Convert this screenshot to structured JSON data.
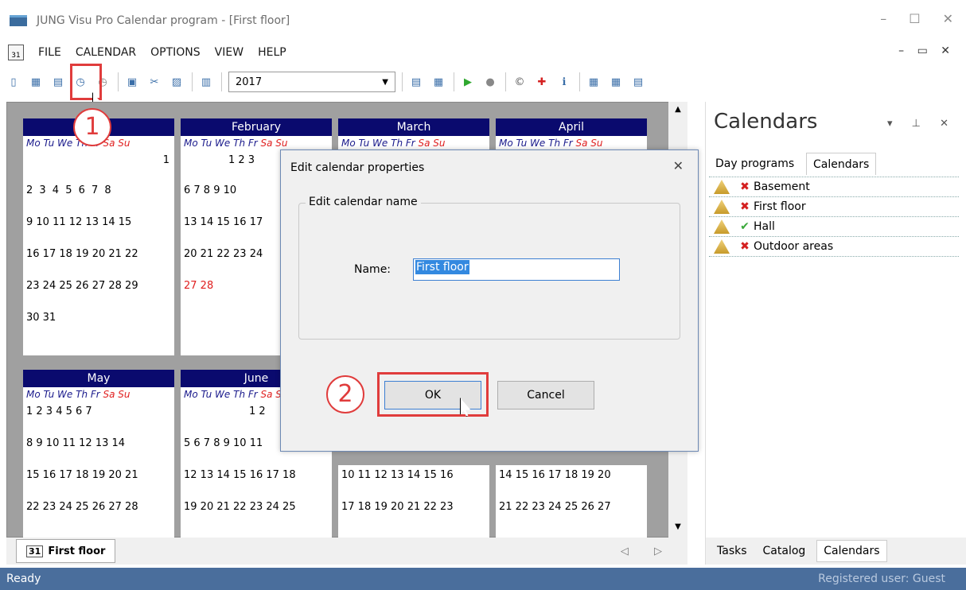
{
  "window": {
    "title": "JUNG Visu Pro Calendar program - [First floor]"
  },
  "menu": [
    "FILE",
    "CALENDAR",
    "OPTIONS",
    "VIEW",
    "HELP"
  ],
  "toolbar": {
    "year": "2017"
  },
  "months": [
    {
      "name": "January",
      "label_visible": "ary"
    },
    {
      "name": "February",
      "label_visible": "February"
    },
    {
      "name": "March",
      "label_visible": "March"
    },
    {
      "name": "April",
      "label_visible": "April"
    },
    {
      "name": "May",
      "label_visible": "May"
    },
    {
      "name": "June",
      "label_visible": "June"
    }
  ],
  "dow_labels": [
    "Mo",
    "Tu",
    "We",
    "Th",
    "Fr",
    "Sa",
    "Su"
  ],
  "calendar_rows": {
    "jan": [
      "1",
      "2 3 4 5 6 7 8",
      "9 10 11 12 13 14 15",
      "16 17 18 19 20 21 22",
      "23 24 25 26 27 28 29",
      "30 31"
    ],
    "feb": [
      "1 2 3",
      "6 7 8 9 10",
      "13 14 15 16 17",
      "20 21 22 23 24",
      "27 28"
    ],
    "may": [
      "1 2 3 4 5 6 7",
      "8 9 10 11 12 13 14",
      "15 16 17 18 19 20 21",
      "22 23 24 25 26 27 28"
    ],
    "jun": [
      "1 2",
      "5 6 7 8 9 10 11",
      "12 13 14 15 16 17 18",
      "19 20 21 22 23 24 25"
    ],
    "jul": [
      "10 11 12 13 14 15 16",
      "17 18 19 20 21 22 23"
    ],
    "aug": [
      "14 15 16 17 18 19 20",
      "21 22 23 24 25 26 27"
    ]
  },
  "doc_tab": {
    "label": "First floor"
  },
  "panel": {
    "title": "Calendars",
    "tabs": [
      "Day programs",
      "Calendars"
    ],
    "calendars": [
      {
        "name": "Basement",
        "status": "✖"
      },
      {
        "name": "First floor",
        "status": "✖"
      },
      {
        "name": "Hall",
        "status": "✔"
      },
      {
        "name": "Outdoor areas",
        "status": "✖"
      }
    ],
    "bottom_tabs": [
      "Tasks",
      "Catalog",
      "Calendars"
    ]
  },
  "dialog": {
    "title": "Edit calendar properties",
    "group": "Edit calendar name",
    "name_label": "Name:",
    "name_value": "First floor",
    "ok": "OK",
    "cancel": "Cancel"
  },
  "badges": [
    "1",
    "2"
  ],
  "status": {
    "left": "Ready",
    "right": "Registered user: Guest"
  }
}
